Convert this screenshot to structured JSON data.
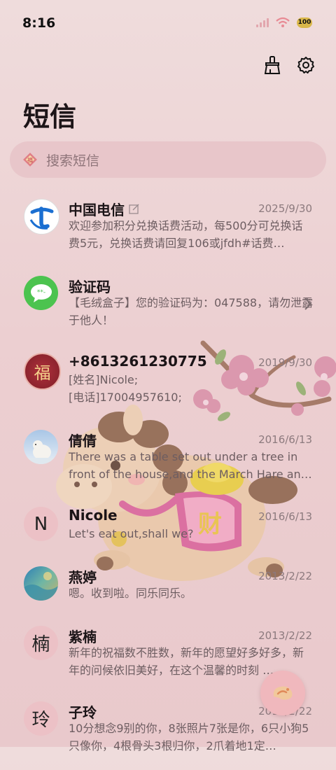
{
  "status_bar": {
    "time": "8:16",
    "battery": "100"
  },
  "header": {
    "title": "短信"
  },
  "search": {
    "placeholder": "搜索短信"
  },
  "colors": {
    "accent": "#f0b8bd",
    "search_bg": "#e8c6ca",
    "telecom_blue": "#1b6fd1",
    "sms_green": "#4cc34f"
  },
  "messages": [
    {
      "name": "中国电信",
      "date": "2025/9/30",
      "snippet": "欢迎参加积分兑换话费活动，每500分可兑换话费5元，兑换话费请回复106或jfdh#话费…"
    },
    {
      "name": "验证码",
      "date": "",
      "snippet": "【毛绒盒子】您的验证码为：047588，请勿泄露于他人！"
    },
    {
      "name": "+8613261230775",
      "date": "2019/9/30",
      "snippet": "[姓名]Nicole;\n[电话]17004957610;"
    },
    {
      "name": "倩倩",
      "date": "2016/6/13",
      "snippet": "There was a table set out under a tree in front of the house,and the March Hare an…"
    },
    {
      "name": "Nicole",
      "date": "2016/6/13",
      "snippet": "Let's eat out,shall we?",
      "avatar": "N"
    },
    {
      "name": "燕婷",
      "date": "2013/2/22",
      "snippet": "嗯。收到啦。同乐同乐。"
    },
    {
      "name": "紫楠",
      "date": "2013/2/22",
      "snippet": "新年的祝福数不胜数，新年的愿望好多好多，新年的问候依旧美好，在这个温馨的时刻 …",
      "avatar": "楠"
    },
    {
      "name": "子玲",
      "date": "2013/2/22",
      "snippet": "10分想念9别的你，8张照片7张是你，6只小狗5只像你，4根骨头3根归你，2爪着地1定…",
      "avatar": "玲"
    }
  ]
}
